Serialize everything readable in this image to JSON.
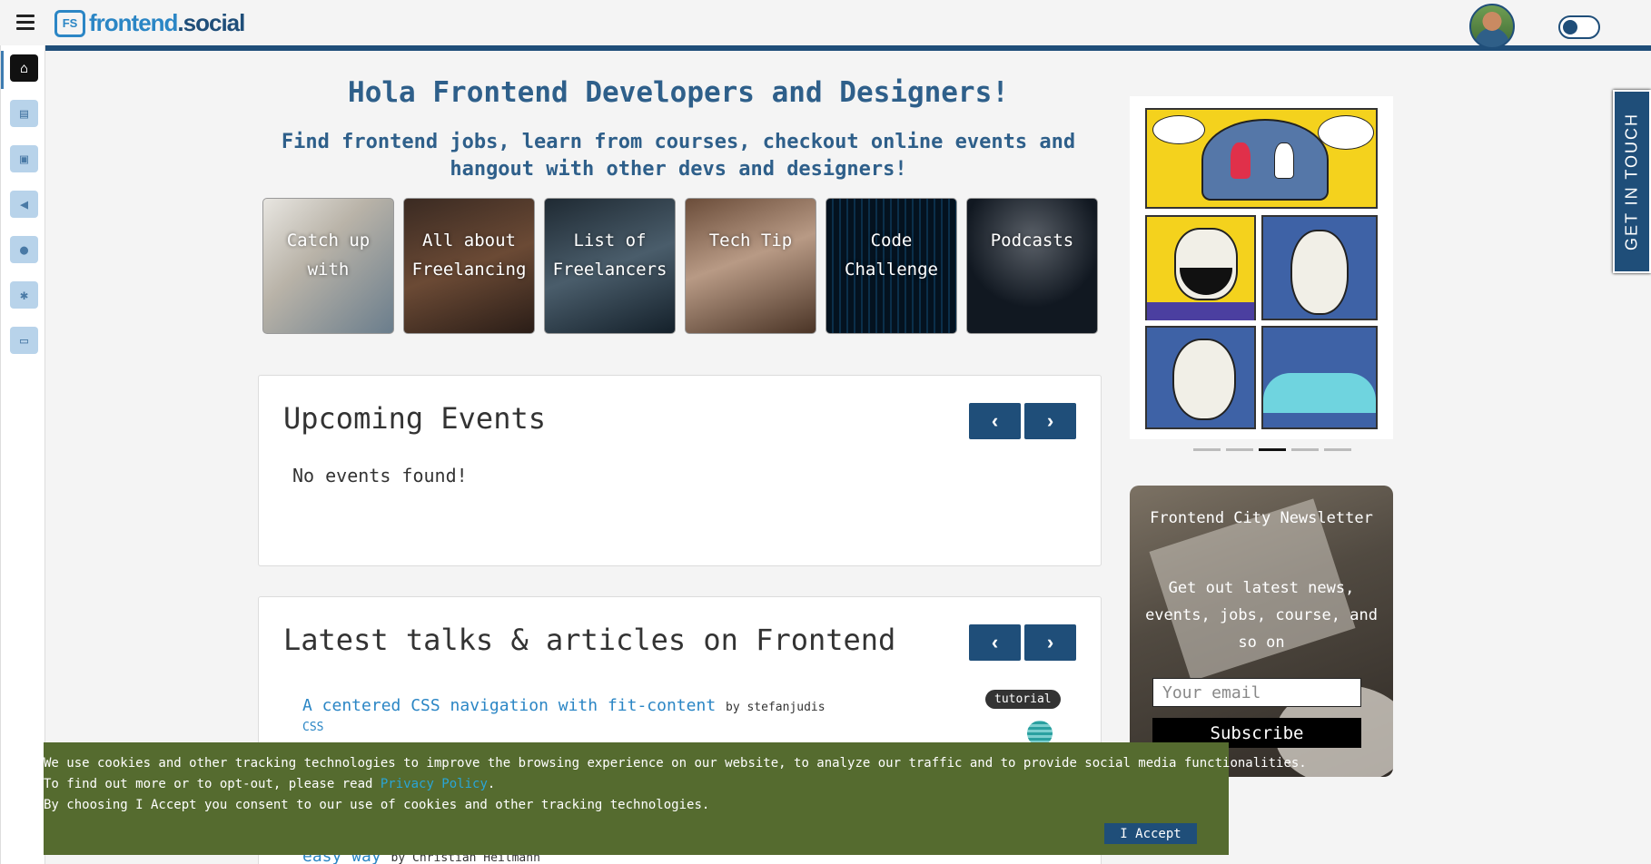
{
  "header": {
    "logo_mark": "FS",
    "logo_text_1": "frontend",
    "logo_text_2": ".social"
  },
  "sidebar": {
    "items": [
      {
        "name": "home",
        "icon": "home-icon",
        "glyph": "⌂"
      },
      {
        "name": "courses",
        "icon": "book-icon",
        "glyph": "▤"
      },
      {
        "name": "jobs",
        "icon": "briefcase-icon",
        "glyph": "▣"
      },
      {
        "name": "events",
        "icon": "megaphone-icon",
        "glyph": "◀"
      },
      {
        "name": "locations",
        "icon": "map-marker-icon",
        "glyph": "●"
      },
      {
        "name": "settings",
        "icon": "gear-icon",
        "glyph": "✱"
      },
      {
        "name": "desktop",
        "icon": "desktop-icon",
        "glyph": "▭"
      }
    ]
  },
  "hero": {
    "title": "Hola Frontend Developers and Designers!",
    "subtitle": "Find frontend jobs, learn from courses, checkout online events and hangout with other devs and designers!"
  },
  "categories": [
    {
      "label": "Catch up with",
      "bg": "linear-gradient(135deg,#e8e6e1,#b9b3a8 40%,#6a7d8c)"
    },
    {
      "label": "All about Freelancing",
      "bg": "linear-gradient(160deg,#3a2a22,#6b4a35 50%,#2a1d17)"
    },
    {
      "label": "List of Freelancers",
      "bg": "linear-gradient(160deg,#1f2a33,#4a5d6b 50%,#14202a)"
    },
    {
      "label": "Tech Tip",
      "bg": "linear-gradient(160deg,#6b4d3a,#b89a85 45%,#4a3426)"
    },
    {
      "label": "Code Challenge",
      "bg": "repeating-linear-gradient(90deg,#04121f 0 6px,#0b2f4a 6px 8px)"
    },
    {
      "label": "Podcasts",
      "bg": "radial-gradient(circle at 50% 30%,#5a6068,#111821 60%)"
    }
  ],
  "events": {
    "title": "Upcoming Events",
    "empty_text": "No events found!",
    "prev": "‹",
    "next": "›"
  },
  "articles": {
    "title": "Latest talks & articles on Frontend",
    "prev": "‹",
    "next": "›",
    "items": [
      {
        "title": "A centered CSS navigation with fit-content",
        "by": "by",
        "author": "stefanjudis",
        "tag": "CSS",
        "badge": "tutorial"
      },
      {
        "title": "easy way",
        "by": "by",
        "author": "Christian Heilmann"
      }
    ]
  },
  "newsletter": {
    "title": "Frontend City Newsletter",
    "text": "Get out latest news, events, jobs, course, and so on",
    "placeholder": "Your email",
    "button": "Subscribe"
  },
  "get_in_touch": "GET IN TOUCH",
  "cookie": {
    "line1": "We use cookies and other tracking technologies to improve the browsing experience on our website, to analyze our traffic and to provide social media functionalities.",
    "line2_pre": "To find out more or to opt-out, please read ",
    "line2_link": "Privacy Policy",
    "line2_post": ".",
    "line3": "By choosing I Accept you consent to our use of cookies and other tracking technologies.",
    "accept": "I Accept"
  },
  "carousel": {
    "slide_count": 5,
    "active_index": 2
  }
}
